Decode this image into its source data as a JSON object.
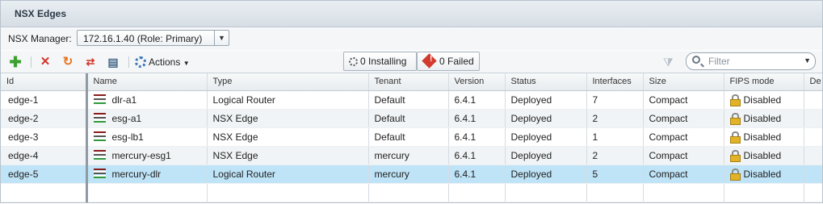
{
  "panel": {
    "title": "NSX Edges"
  },
  "manager": {
    "label": "NSX Manager:",
    "selected": "172.16.1.40 (Role: Primary)"
  },
  "toolbar": {
    "actions_label": "Actions",
    "installing_label": "0 Installing",
    "failed_label": "0 Failed",
    "filter_placeholder": "Filter"
  },
  "colors": {
    "add": "#3aa02f",
    "delete": "#d3362b",
    "refresh": "#e8731c",
    "selected_row": "#bfe3f7",
    "failed_badge": "#d23b2e"
  },
  "table": {
    "columns": [
      "Id",
      "Name",
      "Type",
      "Tenant",
      "Version",
      "Status",
      "Interfaces",
      "Size",
      "FIPS mode",
      "De"
    ],
    "rows": [
      {
        "id": "edge-1",
        "name": "dlr-a1",
        "type": "Logical Router",
        "tenant": "Default",
        "version": "6.4.1",
        "status": "Deployed",
        "interfaces": "7",
        "size": "Compact",
        "fips": "Disabled"
      },
      {
        "id": "edge-2",
        "name": "esg-a1",
        "type": "NSX Edge",
        "tenant": "Default",
        "version": "6.4.1",
        "status": "Deployed",
        "interfaces": "2",
        "size": "Compact",
        "fips": "Disabled"
      },
      {
        "id": "edge-3",
        "name": "esg-lb1",
        "type": "NSX Edge",
        "tenant": "Default",
        "version": "6.4.1",
        "status": "Deployed",
        "interfaces": "1",
        "size": "Compact",
        "fips": "Disabled"
      },
      {
        "id": "edge-4",
        "name": "mercury-esg1",
        "type": "NSX Edge",
        "tenant": "mercury",
        "version": "6.4.1",
        "status": "Deployed",
        "interfaces": "2",
        "size": "Compact",
        "fips": "Disabled"
      },
      {
        "id": "edge-5",
        "name": "mercury-dlr",
        "type": "Logical Router",
        "tenant": "mercury",
        "version": "6.4.1",
        "status": "Deployed",
        "interfaces": "5",
        "size": "Compact",
        "fips": "Disabled"
      }
    ],
    "selected_index": 4
  }
}
